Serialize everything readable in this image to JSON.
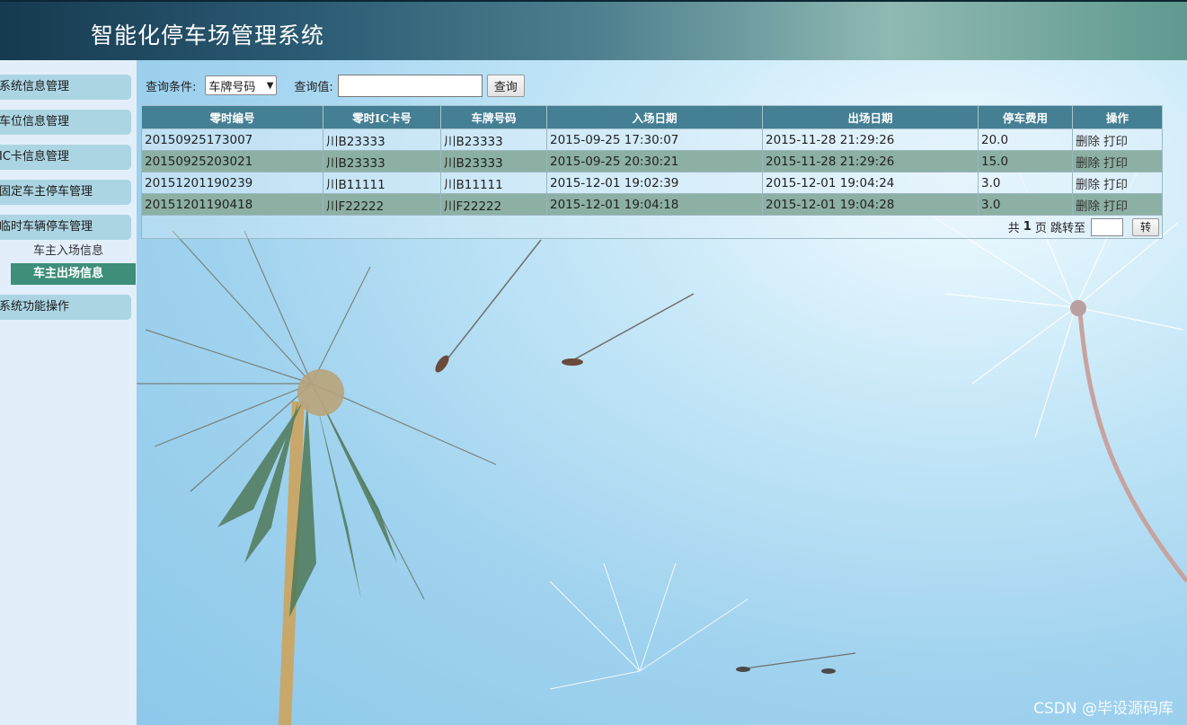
{
  "header": {
    "title": "智能化停车场管理系统"
  },
  "sidebar": {
    "menu": [
      {
        "label": "系统信息管理"
      },
      {
        "label": "车位信息管理"
      },
      {
        "label": "IC卡信息管理"
      },
      {
        "label": "固定车主停车管理"
      },
      {
        "label": "临时车辆停车管理"
      },
      {
        "label": "系统功能操作"
      }
    ],
    "submenu": [
      {
        "label": "车主入场信息"
      },
      {
        "label": "车主出场信息"
      }
    ]
  },
  "search": {
    "condition_label": "查询条件:",
    "condition_value": "车牌号码",
    "value_label": "查询值:",
    "value_input": "",
    "button": "查询"
  },
  "table": {
    "columns": [
      "零时编号",
      "零时IC卡号",
      "车牌号码",
      "入场日期",
      "出场日期",
      "停车费用",
      "操作"
    ],
    "rows": [
      [
        "20150925173007",
        "川B23333",
        "川B23333",
        "2015-09-25 17:30:07",
        "2015-11-28 21:29:26",
        "20.0"
      ],
      [
        "20150925203021",
        "川B23333",
        "川B23333",
        "2015-09-25 20:30:21",
        "2015-11-28 21:29:26",
        "15.0"
      ],
      [
        "20151201190239",
        "川B11111",
        "川B11111",
        "2015-12-01 19:02:39",
        "2015-12-01 19:04:24",
        "3.0"
      ],
      [
        "20151201190418",
        "川F22222",
        "川F22222",
        "2015-12-01 19:04:18",
        "2015-12-01 19:04:28",
        "3.0"
      ]
    ],
    "actions": {
      "delete": "删除",
      "print": "打印"
    }
  },
  "pager": {
    "prefix": "共",
    "pages": "1",
    "suffix": "页 跳转至",
    "button": "转"
  },
  "watermark": "CSDN @毕设源码库"
}
